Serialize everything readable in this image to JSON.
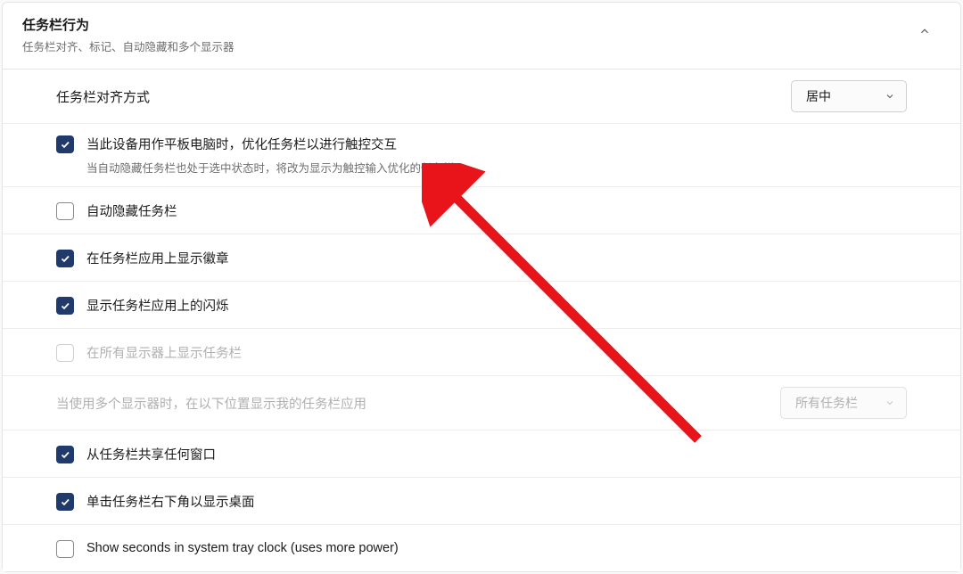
{
  "header": {
    "title": "任务栏行为",
    "subtitle": "任务栏对齐、标记、自动隐藏和多个显示器"
  },
  "rows": {
    "alignment": {
      "label": "任务栏对齐方式",
      "dropdown_value": "居中"
    },
    "tablet": {
      "label": "当此设备用作平板电脑时，优化任务栏以进行触控交互",
      "sublabel": "当自动隐藏任务栏也处于选中状态时，将改为显示为触控输入优化的任务栏",
      "checked": true
    },
    "autohide": {
      "label": "自动隐藏任务栏",
      "checked": false
    },
    "badges": {
      "label": "在任务栏应用上显示徽章",
      "checked": true
    },
    "flashing": {
      "label": "显示任务栏应用上的闪烁",
      "checked": true
    },
    "all_displays": {
      "label": "在所有显示器上显示任务栏",
      "checked": false,
      "disabled": true
    },
    "multi_display": {
      "label": "当使用多个显示器时，在以下位置显示我的任务栏应用",
      "dropdown_value": "所有任务栏",
      "disabled": true
    },
    "share_window": {
      "label": "从任务栏共享任何窗口",
      "checked": true
    },
    "show_desktop": {
      "label": "单击任务栏右下角以显示桌面",
      "checked": true
    },
    "show_seconds": {
      "label": "Show seconds in system tray clock (uses more power)",
      "checked": false
    }
  }
}
